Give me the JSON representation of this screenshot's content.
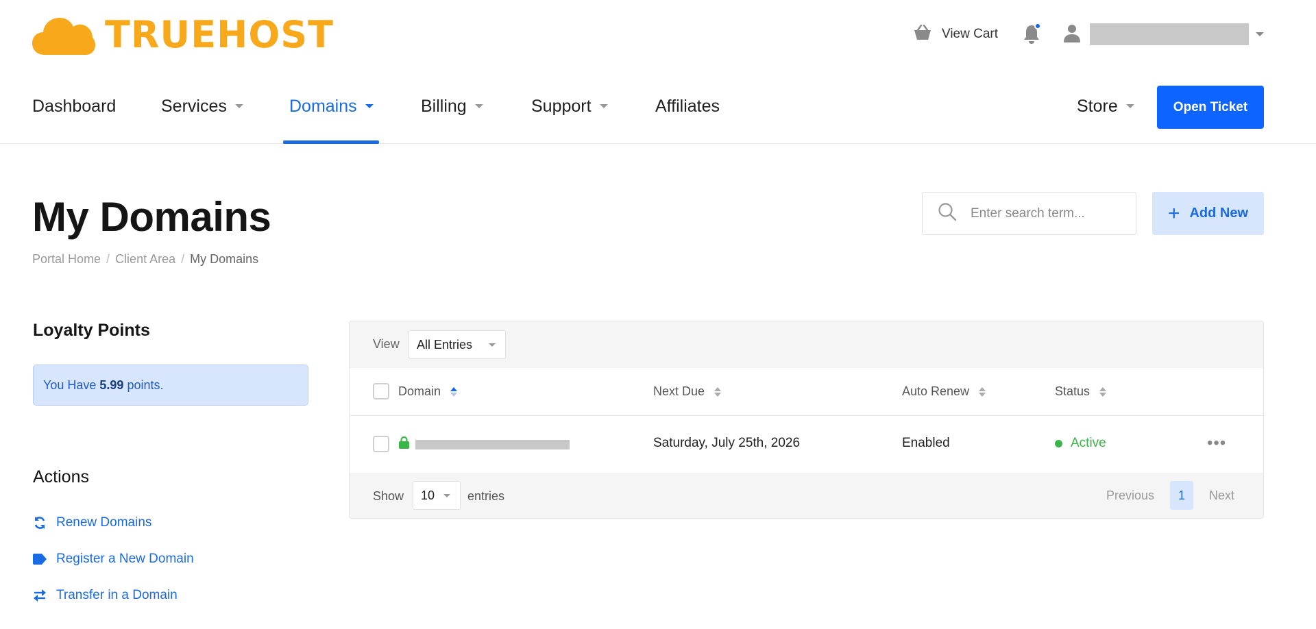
{
  "brand": {
    "name": "TRUEHOST",
    "color": "#f7a81b",
    "logo_icon": "cloud-icon"
  },
  "header": {
    "cart_label": "View Cart",
    "cart_icon": "basket-icon",
    "notification_icon": "bell-icon",
    "user_icon": "user-icon"
  },
  "nav": {
    "items": [
      {
        "label": "Dashboard"
      },
      {
        "label": "Services"
      },
      {
        "label": "Domains"
      },
      {
        "label": "Billing"
      },
      {
        "label": "Support"
      },
      {
        "label": "Affiliates"
      }
    ],
    "active": "Domains",
    "store_label": "Store",
    "open_ticket_label": "Open Ticket"
  },
  "page": {
    "title": "My Domains",
    "breadcrumb": [
      "Portal Home",
      "Client Area",
      "My Domains"
    ],
    "search_placeholder": "Enter search term...",
    "add_new_label": "Add New"
  },
  "sidebar": {
    "loyalty_heading": "Loyalty Points",
    "loyalty_prefix": "You Have",
    "loyalty_points": "5.99",
    "loyalty_suffix": "points.",
    "actions_heading": "Actions",
    "actions": [
      {
        "label": "Renew Domains",
        "icon": "sync-icon"
      },
      {
        "label": "Register a New Domain",
        "icon": "tag-icon"
      },
      {
        "label": "Transfer in a Domain",
        "icon": "exchange-icon"
      }
    ]
  },
  "table": {
    "view_label": "View",
    "view_value": "All Entries",
    "columns": [
      "Domain",
      "Next Due",
      "Auto Renew",
      "Status"
    ],
    "rows": [
      {
        "next_due": "Saturday, July 25th, 2026",
        "auto_renew": "Enabled",
        "status": "Active"
      }
    ],
    "show_label": "Show",
    "page_length": "10",
    "entries_label": "entries",
    "pagination": {
      "previous": "Previous",
      "current": "1",
      "next": "Next"
    }
  },
  "colors": {
    "accent": "#1a6ae3",
    "primary_button": "#0d64ff",
    "success": "#3bb54a",
    "brand": "#f7a81b"
  }
}
